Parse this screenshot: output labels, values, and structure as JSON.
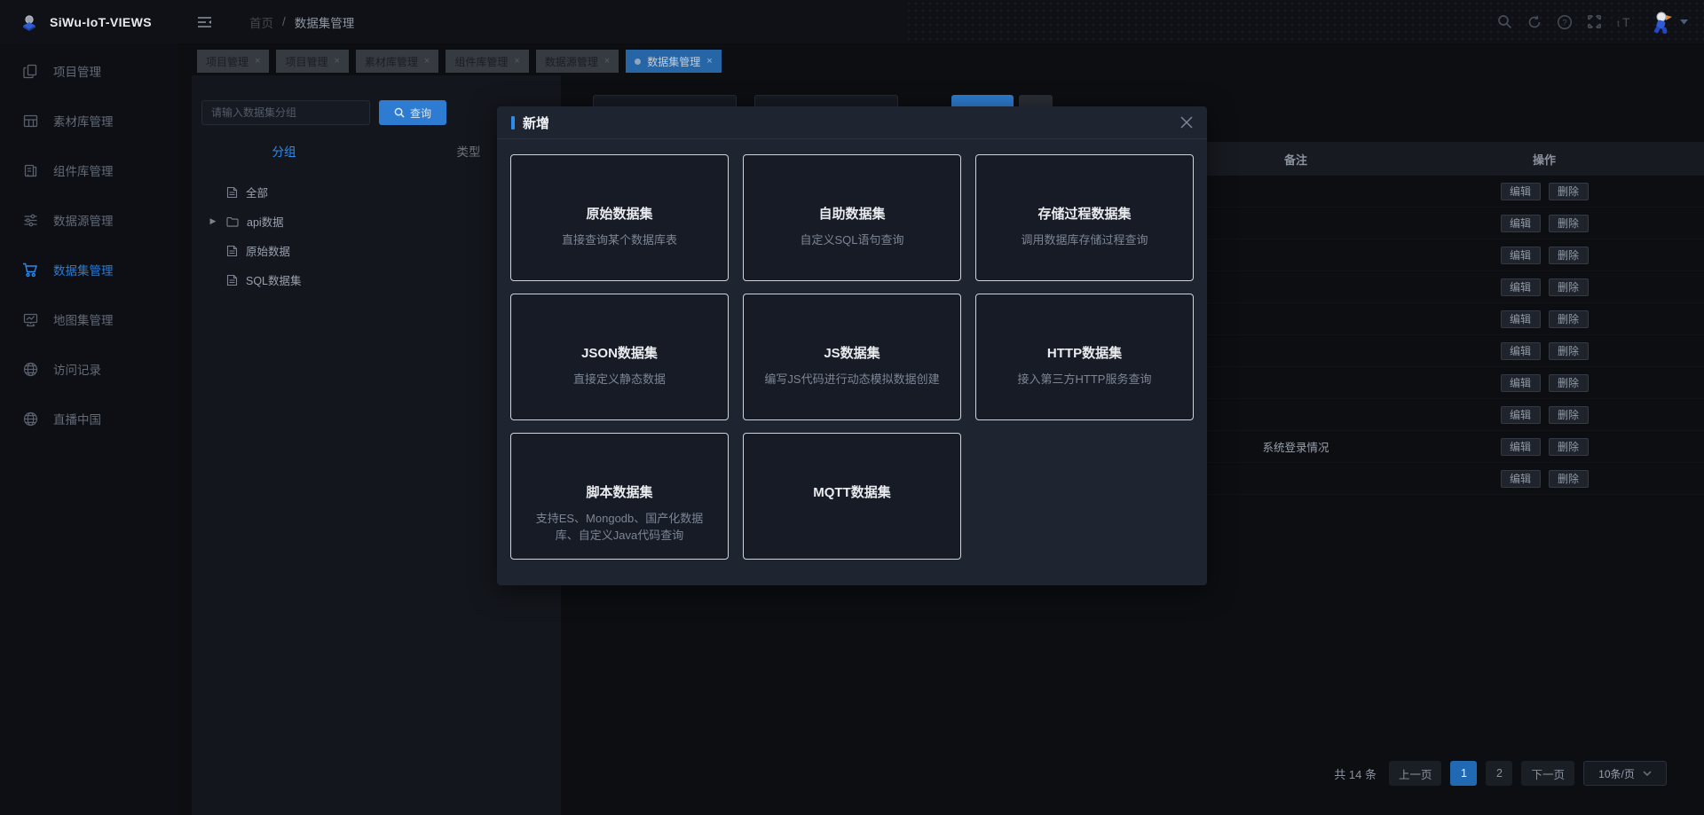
{
  "app": {
    "title": "SiWu-IoT-VIEWS"
  },
  "topbar": {
    "collapse_icon": "menu-collapse-icon",
    "breadcrumb": {
      "home": "首页",
      "separator": "/",
      "current": "数据集管理"
    },
    "action_icons": [
      "search-icon",
      "refresh-icon",
      "help-icon",
      "fullscreen-icon",
      "font-size-icon"
    ],
    "avatar_icon": "astronaut-avatar",
    "caret_icon": "caret-down-icon"
  },
  "sidebar": {
    "items": [
      {
        "label": "项目管理",
        "icon": "project-icon",
        "active": false
      },
      {
        "label": "素材库管理",
        "icon": "material-icon",
        "active": false
      },
      {
        "label": "组件库管理",
        "icon": "component-icon",
        "active": false
      },
      {
        "label": "数据源管理",
        "icon": "datasource-icon",
        "active": false
      },
      {
        "label": "数据集管理",
        "icon": "dataset-icon",
        "active": true
      },
      {
        "label": "地图集管理",
        "icon": "mapset-icon",
        "active": false
      },
      {
        "label": "访问记录",
        "icon": "globe-icon",
        "active": false
      },
      {
        "label": "直播中国",
        "icon": "globe-icon",
        "active": false
      }
    ]
  },
  "open_tabs": [
    {
      "label": "项目管理",
      "active": false
    },
    {
      "label": "项目管理",
      "active": false
    },
    {
      "label": "素材库管理",
      "active": false
    },
    {
      "label": "组件库管理",
      "active": false
    },
    {
      "label": "数据源管理",
      "active": false
    },
    {
      "label": "数据集管理",
      "active": true
    }
  ],
  "group_panel": {
    "search_placeholder": "请输入数据集分组",
    "search_button": "查询",
    "view_tabs": [
      {
        "label": "分组",
        "active": true
      },
      {
        "label": "类型",
        "active": false
      }
    ],
    "tree": [
      {
        "label": "全部",
        "icon": "file-icon",
        "expandable": false
      },
      {
        "label": "api数据",
        "icon": "folder-icon",
        "expandable": true
      },
      {
        "label": "原始数据",
        "icon": "file-icon",
        "expandable": false
      },
      {
        "label": "SQL数据集",
        "icon": "file-icon",
        "expandable": false
      }
    ]
  },
  "table": {
    "columns": {
      "remark": "备注",
      "actions": "操作"
    },
    "edit_label": "编辑",
    "delete_label": "删除",
    "rows": [
      {
        "remark": ""
      },
      {
        "remark": ""
      },
      {
        "remark": ""
      },
      {
        "remark": ""
      },
      {
        "remark": ""
      },
      {
        "remark": ""
      },
      {
        "remark": ""
      },
      {
        "remark": ""
      },
      {
        "remark": "系统登录情况"
      },
      {
        "remark": ""
      }
    ]
  },
  "modal": {
    "title": "新增",
    "close_icon": "close-icon",
    "cards": [
      {
        "title": "原始数据集",
        "desc": "直接查询某个数据库表"
      },
      {
        "title": "自助数据集",
        "desc": "自定义SQL语句查询"
      },
      {
        "title": "存储过程数据集",
        "desc": "调用数据库存储过程查询"
      },
      {
        "title": "JSON数据集",
        "desc": "直接定义静态数据"
      },
      {
        "title": "JS数据集",
        "desc": "编写JS代码进行动态模拟数据创建"
      },
      {
        "title": "HTTP数据集",
        "desc": "接入第三方HTTP服务查询"
      },
      {
        "title": "脚本数据集",
        "desc": "支持ES、Mongodb、国产化数据库、自定义Java代码查询"
      },
      {
        "title": "MQTT数据集",
        "desc": ""
      }
    ]
  },
  "pagination": {
    "total": "共 14 条",
    "prev": "上一页",
    "pages": [
      {
        "label": "1",
        "active": true
      },
      {
        "label": "2",
        "active": false
      }
    ],
    "next": "下一页",
    "page_size": "10条/页"
  },
  "colors": {
    "accent_blue": "#2d8cf0",
    "primary_button": "#2d7cd1",
    "active_tab": "#2766a6",
    "active_page": "#2269b3"
  }
}
